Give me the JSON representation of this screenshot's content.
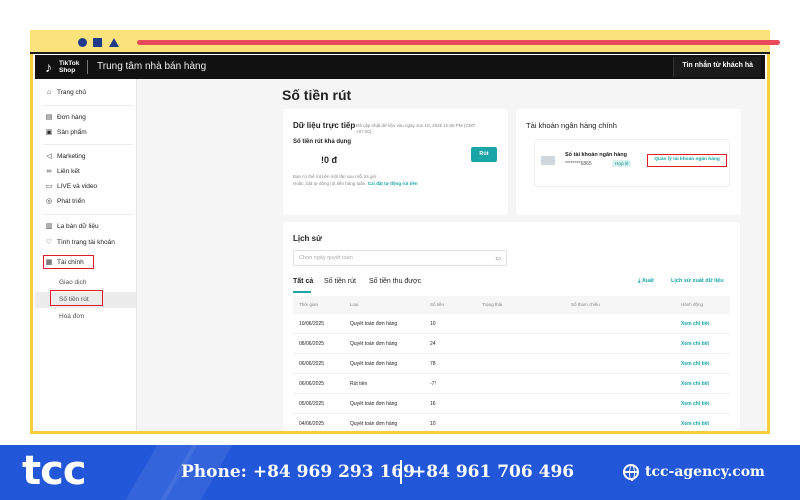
{
  "topbar": {
    "brand_line1": "TikTok",
    "brand_line2": "Shop",
    "title": "Trung tâm nhà bán hàng",
    "inbox": "Tin nhắn từ khách hà"
  },
  "sidebar": {
    "items": [
      {
        "label": "Trang chủ",
        "icon": "home-icon"
      },
      {
        "label": "Đơn hàng",
        "icon": "orders-icon"
      },
      {
        "label": "Sản phẩm",
        "icon": "products-icon"
      },
      {
        "label": "Marketing",
        "icon": "megaphone-icon"
      },
      {
        "label": "Liên kết",
        "icon": "link-icon"
      },
      {
        "label": "LIVE và video",
        "icon": "video-icon"
      },
      {
        "label": "Phát triển",
        "icon": "growth-icon"
      },
      {
        "label": "La bàn dữ liệu",
        "icon": "chart-icon"
      },
      {
        "label": "Tình trạng tài khoản",
        "icon": "shield-icon"
      },
      {
        "label": "Tài chính",
        "icon": "finance-icon"
      }
    ],
    "sub_items": [
      "Giao dịch",
      "Số tiền rút",
      "Hoá đơn"
    ]
  },
  "page": {
    "title": "Số tiền rút"
  },
  "live_card": {
    "title": "Dữ liệu trực tiếp",
    "subtitle": "Đã cập nhật dữ liệu vào ngày Jun 10, 2025 10:55 PM (GMT +07:00)",
    "label": "Số tiền rút khả dụng",
    "amount": "!0 đ",
    "button": "Rút",
    "note": "Bạn có thể rút tiền một lần sau mỗi 24 giờ",
    "note2": "Hoặc, bật tự động rút tiền hàng tuần.",
    "note_link": "Cài đặt tự động rút tiền"
  },
  "bank_card": {
    "title": "Tài khoản ngân hàng chính",
    "bank_title": "Số tài khoản ngân hàng",
    "bank_number": "********6865",
    "badge": "Hợp lệ",
    "manage": "Quản lý tài khoản ngân hàng"
  },
  "history": {
    "title": "Lịch sử",
    "date_placeholder": "Chọn ngày quyết toán",
    "tabs": [
      "Tất cả",
      "Số tiền rút",
      "Số tiền thu được"
    ],
    "export": "Xuất",
    "export_history": "Lịch sử xuất dữ liệu",
    "columns": [
      "Thời gian",
      "Loại",
      "Số tiền",
      "Trạng thái",
      "Số tham chiếu",
      "Hành động"
    ],
    "rows": [
      {
        "date": "10/06/2025",
        "type": "Quyết toán đơn hàng",
        "amount": "10",
        "action": "Xem chi tiết"
      },
      {
        "date": "08/06/2025",
        "type": "Quyết toán đơn hàng",
        "amount": "24",
        "action": "Xem chi tiết"
      },
      {
        "date": "06/06/2025",
        "type": "Quyết toán đơn hàng",
        "amount": "78",
        "action": "Xem chi tiết"
      },
      {
        "date": "06/06/2025",
        "type": "Rút tiền",
        "amount": "-7!",
        "action": "Xem chi tiết"
      },
      {
        "date": "05/06/2025",
        "type": "Quyết toán đơn hàng",
        "amount": "16",
        "action": "Xem chi tiết"
      },
      {
        "date": "04/06/2025",
        "type": "Quyết toán đơn hàng",
        "amount": "10",
        "action": "Xem chi tiết"
      }
    ]
  },
  "footer": {
    "logo": "tcc",
    "phone1": "Phone: +84 969 293 169",
    "phone2": "+84 961 706 496",
    "website": "tcc-agency.com"
  },
  "colors": {
    "frame_yellow": "#f7cf3e",
    "accent_teal": "#1aa6a6",
    "highlight_red": "#e01b2a",
    "footer_blue": "#2357d9"
  }
}
